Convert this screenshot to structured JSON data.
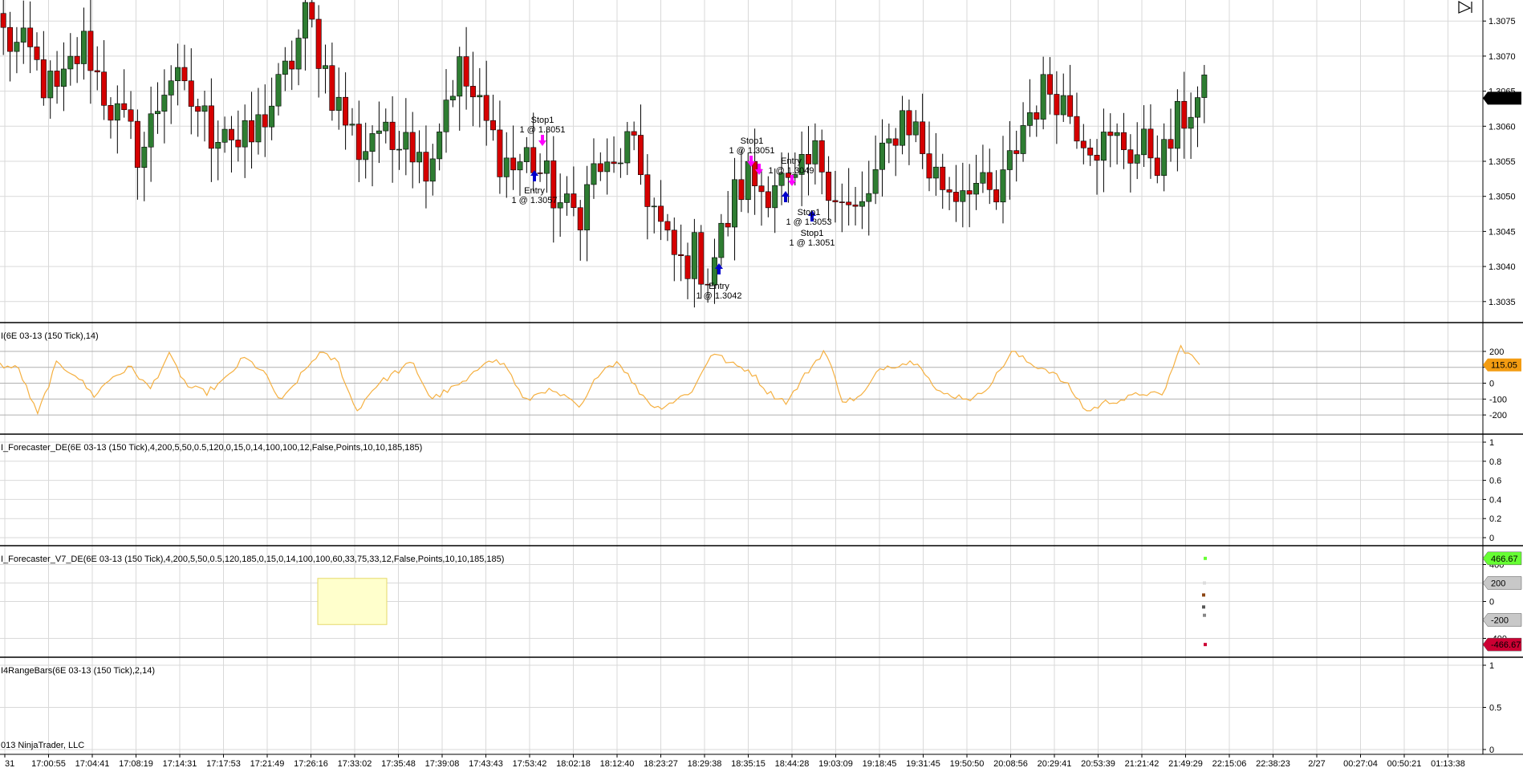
{
  "colors": {
    "up_bar": "#2e7d32",
    "down_bar": "#d50000",
    "wick": "#000000",
    "cci_line": "#f5b041",
    "grid": "#d9d9d9",
    "panel_border": "#000000",
    "buy_arrow": "#0000cc",
    "sell_arrow": "#ff00ff",
    "price_marker_bg": "#000000",
    "cci_marker_bg": "#f39c12",
    "v7_upper_bg": "#66ff33",
    "v7_lower_bg": "#cc0033",
    "v7_mid_bg": "#c8c8c8",
    "highlight_box": "#ffffcc"
  },
  "price_axis": [
    "1.3075",
    "1.3070",
    "1.3065",
    "1.3060",
    "1.3055",
    "1.3050",
    "1.3045",
    "1.3040",
    "1.3035"
  ],
  "last_price": "1.3064",
  "time_axis": [
    "31",
    "17:00:55",
    "17:04:41",
    "17:08:19",
    "17:14:31",
    "17:17:53",
    "17:21:49",
    "17:26:16",
    "17:33:02",
    "17:35:48",
    "17:39:08",
    "17:43:43",
    "17:53:42",
    "18:02:18",
    "18:12:40",
    "18:23:27",
    "18:29:38",
    "18:35:15",
    "18:44:28",
    "19:03:09",
    "19:18:45",
    "19:31:45",
    "19:50:50",
    "20:08:56",
    "20:29:41",
    "20:53:39",
    "21:21:42",
    "21:49:29",
    "22:15:06",
    "22:38:23",
    "2/27",
    "00:27:04",
    "00:50:21",
    "01:13:38"
  ],
  "copyright": "013 NinjaTrader, LLC",
  "panels": {
    "cci": {
      "label": "I(6E 03-13 (150 Tick),14)",
      "ticks": [
        "200",
        "100",
        "0",
        "-100",
        "-200"
      ],
      "marker": "115.05"
    },
    "forecaster": {
      "label": "I_Forecaster_DE(6E 03-13 (150 Tick),4,200,5,50,0.5,120,0,15,0,14,100,100,12,False,Points,10,10,185,185)",
      "ticks": [
        "1",
        "0.8",
        "0.6",
        "0.4",
        "0.2",
        "0"
      ]
    },
    "forecaster_v7": {
      "label": "I_Forecaster_V7_DE(6E 03-13 (150 Tick),4,200,5,50,0.5,120,185,0,15,0,14,100,100,60,33,75,33,12,False,Points,10,10,185,185)",
      "ticks": [
        "400",
        "200",
        "0",
        "-400"
      ],
      "marker_upper": "466.67",
      "marker_mid_up": "200",
      "marker_mid_down": "-200",
      "marker_lower": "-466.67"
    },
    "rangebars": {
      "label": "I4RangeBars(6E 03-13 (150 Tick),2,14)",
      "ticks": [
        "1",
        "0.5",
        "0"
      ]
    }
  },
  "annotations": [
    {
      "line1": "Stop1",
      "line2": "1 @ 1.3051"
    },
    {
      "line1": "Entry",
      "line2": "1 @ 1.3057"
    },
    {
      "line1": "Stop1",
      "line2": "1 @ 1.3051"
    },
    {
      "line1": "Entry",
      "line2": "1 @ 1.3049"
    },
    {
      "line1": "Stop1",
      "line2": "1 @ 1.3053"
    },
    {
      "line1": "Stop1",
      "line2": "1 @ 1.3051"
    },
    {
      "line1": "Entry",
      "line2": "1 @ 1.3042"
    }
  ],
  "chart_data": {
    "type": "candlestick",
    "instrument": "6E 03-13 (150 Tick)",
    "ylim": [
      1.3032,
      1.3078
    ],
    "anchors": [
      1.3073,
      1.3071,
      1.307,
      1.3066,
      1.3064,
      1.3069,
      1.3072,
      1.3066,
      1.3062,
      1.3059,
      1.3056,
      1.3062,
      1.3068,
      1.3064,
      1.3063,
      1.3059,
      1.3061,
      1.3057,
      1.3058,
      1.3062,
      1.3065,
      1.307,
      1.3076,
      1.307,
      1.3064,
      1.306,
      1.3056,
      1.3061,
      1.3056,
      1.3062,
      1.3055,
      1.3056,
      1.3064,
      1.3068,
      1.3064,
      1.306,
      1.3056,
      1.3054,
      1.3056,
      1.3053,
      1.305,
      1.3047,
      1.3049,
      1.3055,
      1.3052,
      1.3058,
      1.3054,
      1.3049,
      1.3043,
      1.304,
      1.3042,
      1.3039,
      1.3044,
      1.305,
      1.3053,
      1.3051,
      1.3053,
      1.305,
      1.3053,
      1.3056,
      1.3052,
      1.3048,
      1.3047,
      1.3052,
      1.3056,
      1.3062,
      1.306,
      1.3054,
      1.3052,
      1.3051,
      1.3053,
      1.305,
      1.3049,
      1.3055,
      1.3061,
      1.3064,
      1.3066,
      1.3063,
      1.306,
      1.3058,
      1.3057,
      1.3058,
      1.3056,
      1.3057,
      1.3055,
      1.306,
      1.3063,
      1.3064
    ],
    "cci_anchors": [
      115,
      90,
      -200,
      120,
      60,
      -80,
      40,
      100,
      -40,
      180,
      -20,
      -60,
      20,
      160,
      80,
      -120,
      40,
      190,
      140,
      -180,
      -20,
      60,
      130,
      -100,
      -40,
      20,
      160,
      110,
      -120,
      -40,
      -80,
      -160,
      80,
      140,
      -40,
      -160,
      -110,
      -40,
      200,
      120,
      80,
      -60,
      -120,
      60,
      210,
      -120,
      -80,
      100,
      120,
      140,
      -60,
      -80,
      -100,
      20,
      200,
      120,
      80,
      -20,
      -180,
      -120,
      -100,
      -60,
      -80,
      230,
      120
    ]
  }
}
